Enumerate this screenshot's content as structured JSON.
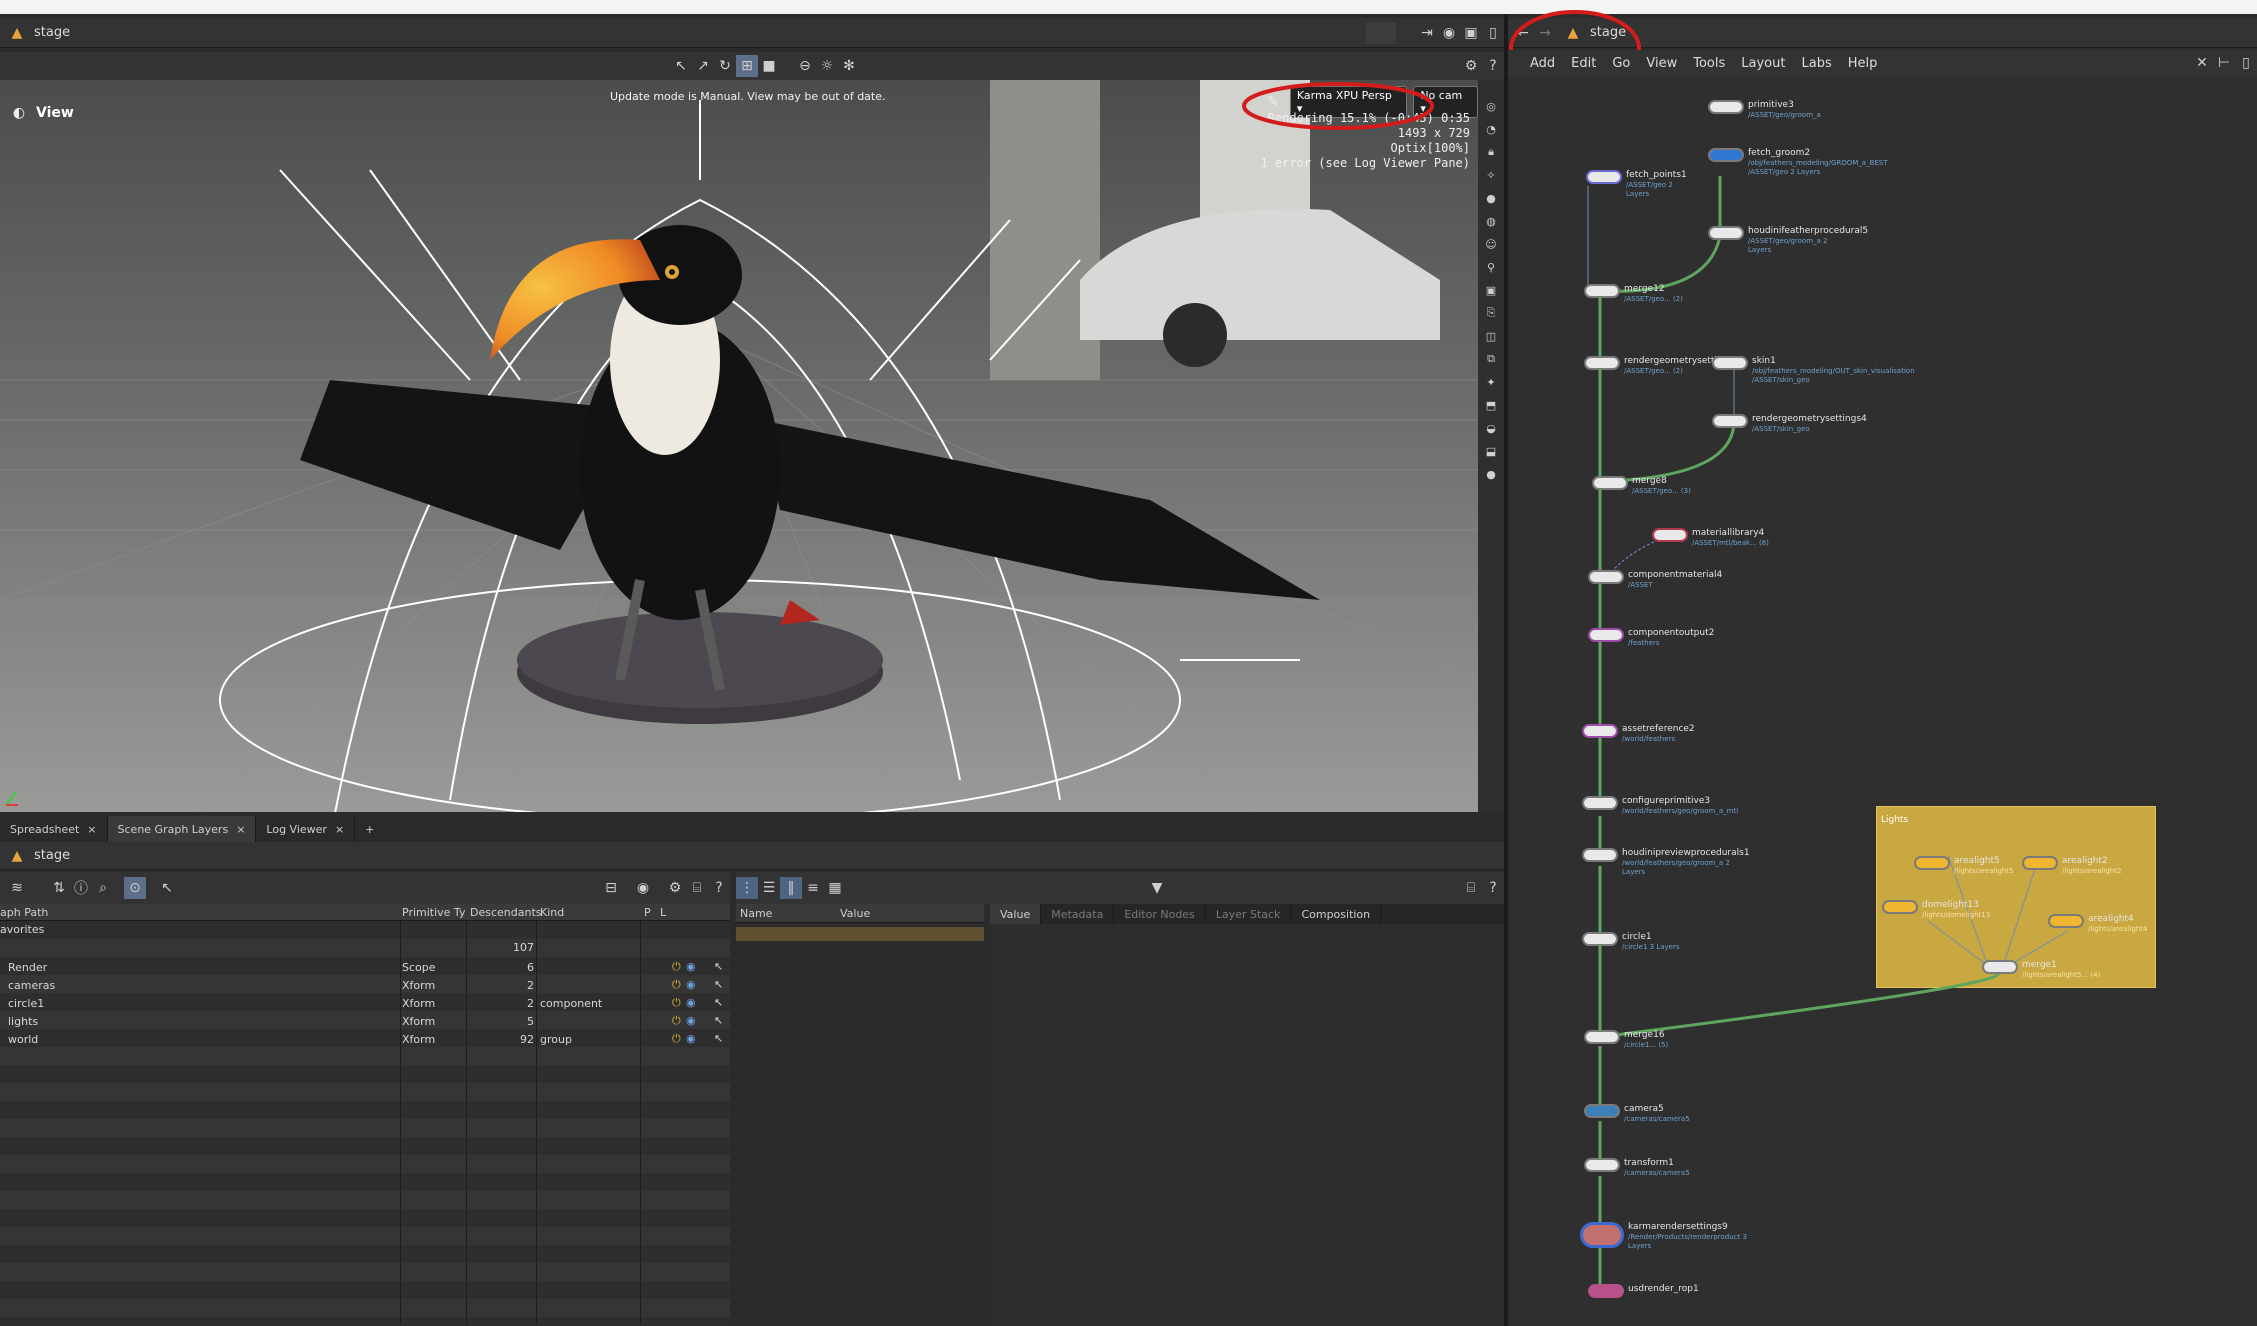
{
  "left_pane": {
    "path_label": "stage",
    "viewport": {
      "title": "View",
      "update_notice": "Update mode is Manual. View may be out of date.",
      "renderer_button": "Karma XPU Persp",
      "camera_button": "No cam",
      "status_lines": [
        "Rendering 15.1% (-0:43) 0:35",
        "1493 x 729",
        "Optix[100%]",
        "1 error (see Log Viewer Pane)"
      ]
    },
    "tabs": [
      {
        "label": "Spreadsheet"
      },
      {
        "label": "Scene Graph Layers"
      },
      {
        "label": "Log Viewer"
      }
    ],
    "add_tab_label": "+",
    "scene_graph": {
      "path_label": "stage",
      "columns": [
        "aph Path",
        "Primitive Ty",
        "Descendants",
        "Kind",
        "P",
        "L"
      ],
      "favorites_label": "avorites",
      "total": "107",
      "rows": [
        {
          "path": "Render",
          "type": "Scope",
          "descendants": "6",
          "kind": ""
        },
        {
          "path": "cameras",
          "type": "Xform",
          "descendants": "2",
          "kind": ""
        },
        {
          "path": "circle1",
          "type": "Xform",
          "descendants": "2",
          "kind": "component"
        },
        {
          "path": "lights",
          "type": "Xform",
          "descendants": "5",
          "kind": ""
        },
        {
          "path": "world",
          "type": "Xform",
          "descendants": "92",
          "kind": "group"
        }
      ]
    },
    "properties": {
      "columns": [
        "Name",
        "Value"
      ],
      "tabs": [
        "Value",
        "Metadata",
        "Editor Nodes",
        "Layer Stack",
        "Composition"
      ]
    }
  },
  "right_pane": {
    "path_label": "stage",
    "menu": [
      "Add",
      "Edit",
      "Go",
      "View",
      "Tools",
      "Layout",
      "Labs",
      "Help"
    ],
    "lights_box_label": "Lights",
    "nodes": [
      {
        "name": "primitive3",
        "sub": "/ASSET/geo/groom_a"
      },
      {
        "name": "fetch_groom2",
        "sub": "/obj/feathers_modeling/GROOM_a_BEST /ASSET/geo 2 Layers"
      },
      {
        "name": "fetch_points1",
        "sub": "/ASSET/geo 2 Layers"
      },
      {
        "name": "houdinifeatherprocedural5",
        "sub": "/ASSET/geo/groom_a 2 Layers"
      },
      {
        "name": "merge12",
        "sub": "/ASSET/geo... (2)"
      },
      {
        "name": "rendergeometrysettings8",
        "sub": "/ASSET/geo... (2)"
      },
      {
        "name": "skin1",
        "sub": "/obj/feathers_modeling/OUT_skin_visualisation /ASSET/skin_geo"
      },
      {
        "name": "rendergeometrysettings4",
        "sub": "/ASSET/skin_geo"
      },
      {
        "name": "merge8",
        "sub": "/ASSET/geo... (3)"
      },
      {
        "name": "materiallibrary4",
        "sub": "/ASSET/mtl/beak... (8)"
      },
      {
        "name": "componentmaterial4",
        "sub": "/ASSET"
      },
      {
        "name": "componentoutput2",
        "sub": "/feathers"
      },
      {
        "name": "assetreference2",
        "sub": "/world/feathers"
      },
      {
        "name": "configureprimitive3",
        "sub": "/world/feathers/geo/groom_a_mtl"
      },
      {
        "name": "houdinipreviewprocedurals1",
        "sub": "/world/feathers/geo/groom_a 2 Layers"
      },
      {
        "name": "circle1",
        "sub": "/circle1 3 Layers"
      },
      {
        "name": "arealight5",
        "sub": "/lights/arealight5"
      },
      {
        "name": "arealight2",
        "sub": "/lights/arealight2"
      },
      {
        "name": "domelight13",
        "sub": "/lights/domelight13"
      },
      {
        "name": "arealight4",
        "sub": "/lights/arealight4"
      },
      {
        "name": "merge1",
        "sub": "/lights/arealight5... (4)"
      },
      {
        "name": "merge16",
        "sub": "/circle1... (5)"
      },
      {
        "name": "camera5",
        "sub": "/cameras/camera5"
      },
      {
        "name": "transform1",
        "sub": "/cameras/camera5"
      },
      {
        "name": "karmarendersettings9",
        "sub": "/Render/Products/renderproduct 3 Layers"
      },
      {
        "name": "usdrender_rop1",
        "sub": ""
      }
    ]
  },
  "colors": {
    "annotation": "#d41c1c",
    "accent_green": "#5fa55f",
    "lights_box": "#c9a741",
    "link_text": "#6fa1cc"
  }
}
